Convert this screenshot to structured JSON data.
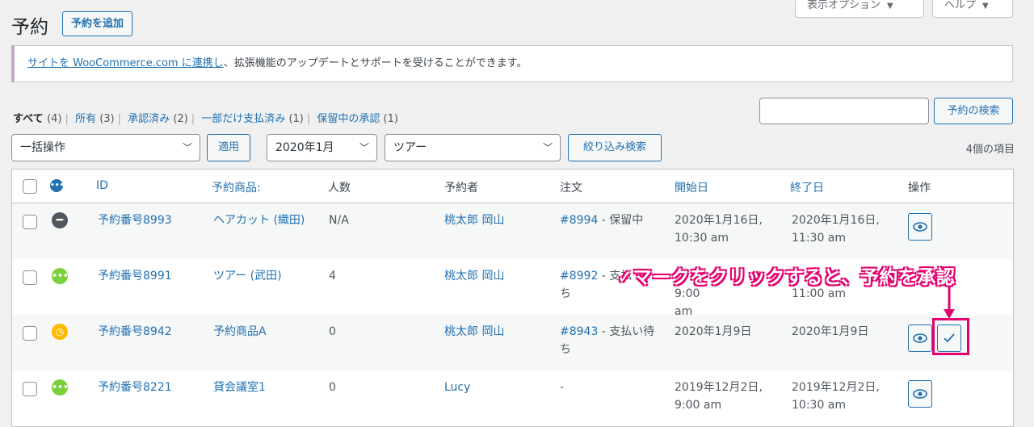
{
  "header": {
    "title": "予約",
    "add_button": "予約を追加",
    "screen_options": "表示オプション",
    "help": "ヘルプ"
  },
  "notice": {
    "link_text": "サイトを WooCommerce.com に連携し",
    "rest_text": "、拡張機能のアップデートとサポートを受けることができます。"
  },
  "views": [
    {
      "label": "すべて",
      "count": "(4)",
      "current": true
    },
    {
      "label": "所有",
      "count": "(3)"
    },
    {
      "label": "承認済み",
      "count": "(2)"
    },
    {
      "label": "一部だけ支払済み",
      "count": "(1)"
    },
    {
      "label": "保留中の承認",
      "count": "(1)"
    }
  ],
  "search": {
    "button": "予約の検索",
    "value": ""
  },
  "filters": {
    "bulk_action": "一括操作",
    "apply": "適用",
    "month": "2020年1月",
    "product": "ツアー",
    "filter_button": "絞り込み検索",
    "item_count": "4個の項目"
  },
  "table": {
    "columns": [
      "ID",
      "予約商品:",
      "人数",
      "予約者",
      "注文",
      "開始日",
      "終了日",
      "操作"
    ],
    "rows": [
      {
        "id": "予約番号8993",
        "product": "ヘアカット (織田)",
        "persons": "N/A",
        "customer": "桃太郎 岡山",
        "order_link": "#8994",
        "order_status": " - 保留中",
        "order_status2": "",
        "start": "2020年1月16日,",
        "start2": "10:30 am",
        "end": "2020年1月16日,",
        "end2": "11:30 am",
        "status_icon": "cancelled-icon",
        "status_color": "#50575e"
      },
      {
        "id": "予約番号8991",
        "product": "ツアー (武田)",
        "persons": "4",
        "customer": "桃太郎 岡山",
        "order_link": "#8992",
        "order_status": " - 支払",
        "order_status2": "ち",
        "start": "",
        "start2": "9:00 am",
        "end": "",
        "end2": "11:00 am",
        "status_icon": "confirmed-icon",
        "status_color": "#7ad03a"
      },
      {
        "id": "予約番号8942",
        "product": "予約商品A",
        "persons": "0",
        "customer": "桃太郎 岡山",
        "order_link": "#8943",
        "order_status": " - 支払い待",
        "order_status2": "ち",
        "start": "2020年1月9日",
        "start2": "",
        "end": "2020年1月9日",
        "end2": "",
        "status_icon": "pending-clock-icon",
        "status_color": "#ffba00"
      },
      {
        "id": "予約番号8221",
        "product": "貸会議室1",
        "persons": "0",
        "customer": "Lucy",
        "order_link": "",
        "order_status": "-",
        "order_status2": "",
        "start": "2019年12月2日,",
        "start2": "9:00 am",
        "end": "2019年12月2日,",
        "end2": "10:30 am",
        "status_icon": "confirmed-icon",
        "status_color": "#7ad03a"
      }
    ]
  },
  "annotation": {
    "text": "✓マークをクリックすると、予約を承認",
    "color": "#e4006f"
  }
}
